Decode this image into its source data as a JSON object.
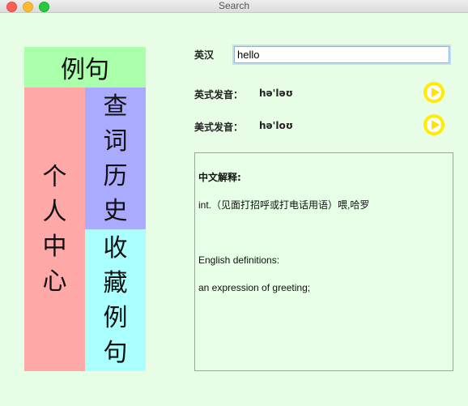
{
  "window": {
    "title": "Search"
  },
  "nav": {
    "examples": "例句",
    "personal_center": [
      "个",
      "人",
      "中",
      "心"
    ],
    "history": [
      "查",
      "词",
      "历",
      "史"
    ],
    "favorites": [
      "收",
      "藏",
      "例",
      "句"
    ]
  },
  "search": {
    "label": "英汉",
    "value": "hello"
  },
  "pronunciation": {
    "uk_label": "英式发音：",
    "uk_phonetic": "hə'ləʊ",
    "us_label": "美式发音：",
    "us_phonetic": "hə'loʊ"
  },
  "definition": {
    "cn_heading": "中文解释:",
    "cn_text": "int.（见面打招呼或打电话用语）喂,哈罗",
    "en_heading": "English definitions:",
    "en_text": "an expression of greeting;"
  },
  "colors": {
    "background": "#e8fde6",
    "examples_block": "#aaffaa",
    "personal_block": "#ffa8a8",
    "history_block": "#aaaaff",
    "favorites_block": "#aaffff",
    "play_button": "#ffec00"
  }
}
